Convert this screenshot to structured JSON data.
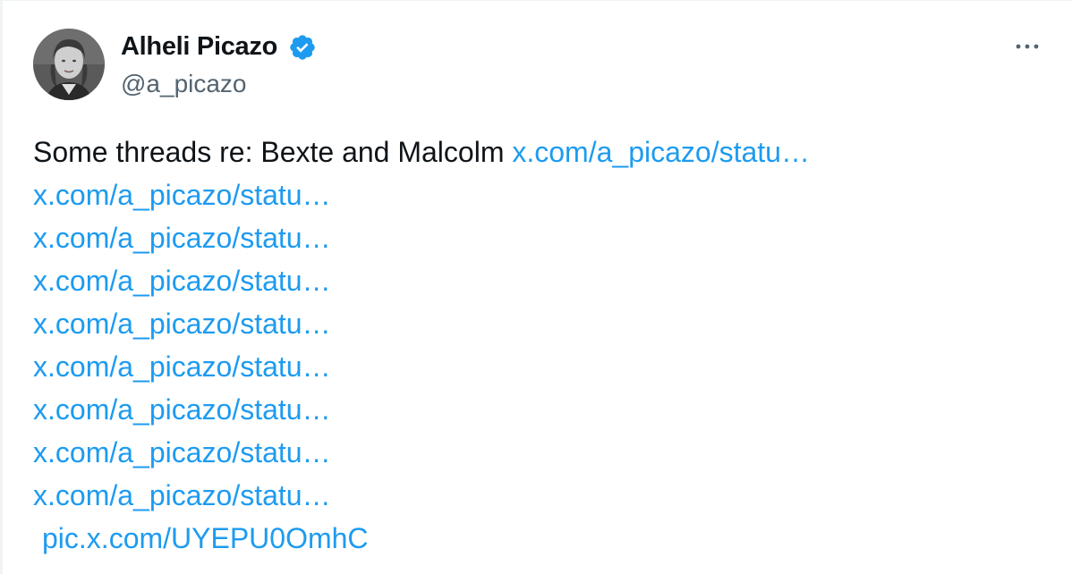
{
  "tweet": {
    "author": {
      "name": "Alheli Picazo",
      "handle": "@a_picazo",
      "verified": true
    },
    "body": {
      "intro": "Some threads re: Bexte and Malcolm ",
      "links": [
        "x.com/a_picazo/statu…",
        "x.com/a_picazo/statu…",
        "x.com/a_picazo/statu…",
        "x.com/a_picazo/statu…",
        "x.com/a_picazo/statu…",
        "x.com/a_picazo/statu…",
        "x.com/a_picazo/statu…",
        "x.com/a_picazo/statu…",
        "x.com/a_picazo/statu…"
      ],
      "pic_link": "pic.x.com/UYEPU0OmhC"
    }
  },
  "icons": {
    "verified": "verified-badge-icon",
    "more": "more-horizontal-icon"
  },
  "colors": {
    "link": "#1d9bf0",
    "text": "#0f1419",
    "secondary": "#536471",
    "verified": "#1d9bf0"
  }
}
